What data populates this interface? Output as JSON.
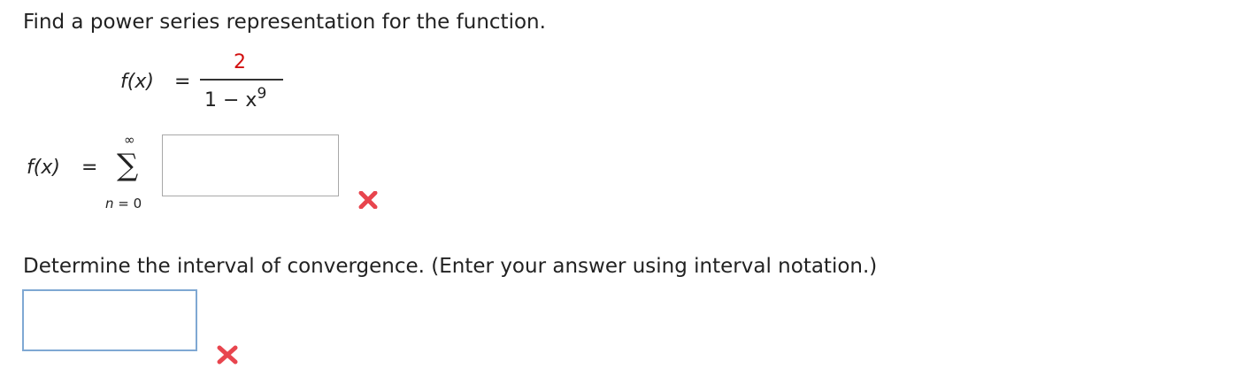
{
  "question": {
    "prompt": "Find a power series representation for the function.",
    "function_label": "f(x)",
    "equals": "=",
    "numerator": "2",
    "denominator_base": "1 − x",
    "denominator_exponent": "9"
  },
  "series": {
    "label": "f(x)",
    "equals": "=",
    "sigma": "∑",
    "upper_limit": "∞",
    "lower_limit": "n = 0",
    "answer_value": "",
    "status_icon": "incorrect-x-icon"
  },
  "interval": {
    "prompt": "Determine the interval of convergence. (Enter your answer using interval notation.)",
    "answer_value": "",
    "status_icon": "incorrect-x-icon"
  },
  "colors": {
    "incorrect": "#e8454e",
    "numerator": "#d20f0f",
    "active_border": "#7fa8d3",
    "inactive_border": "#a8a8a8"
  }
}
